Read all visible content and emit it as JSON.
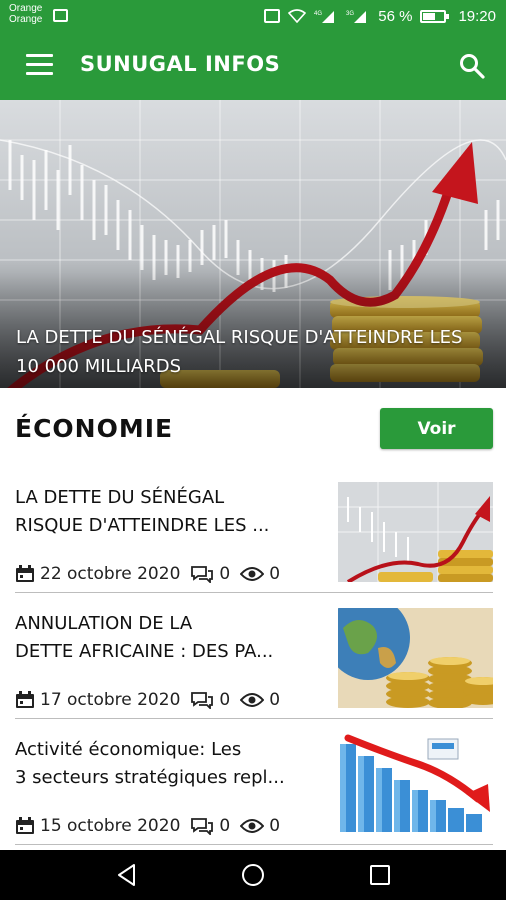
{
  "status_bar": {
    "carrier_line1": "Orange",
    "carrier_line2": "Orange",
    "battery_text": "56 %",
    "time": "19:20",
    "net1": "4G",
    "net2": "3G"
  },
  "app_bar": {
    "title": "SUNUGAL INFOS",
    "menu_icon": "hamburger-menu-icon",
    "search_icon": "search-icon",
    "color": "#2a9a3a"
  },
  "hero": {
    "title": "LA DETTE DU SÉNÉGAL RISQUE D'ATTEINDRE LES 10 000 MILLIARDS"
  },
  "section": {
    "title": "ÉCONOMIE",
    "button_label": "Voir"
  },
  "articles": [
    {
      "title_line1": "LA DETTE DU SÉNÉGAL",
      "title_line2": "RISQUE D'ATTEINDRE LES ...",
      "date": "22 octobre 2020",
      "comments": "0",
      "views": "0"
    },
    {
      "title_line1": "ANNULATION DE LA",
      "title_line2": "DETTE AFRICAINE : DES PA...",
      "date": "17 octobre 2020",
      "comments": "0",
      "views": "0"
    },
    {
      "title_line1": "Activité économique: Les",
      "title_line2": "3 secteurs stratégiques repl...",
      "date": "15 octobre 2020",
      "comments": "0",
      "views": "0"
    }
  ],
  "nav_bar": {
    "back_icon": "back-triangle-icon",
    "home_icon": "home-circle-icon",
    "recents_icon": "recents-square-icon"
  }
}
